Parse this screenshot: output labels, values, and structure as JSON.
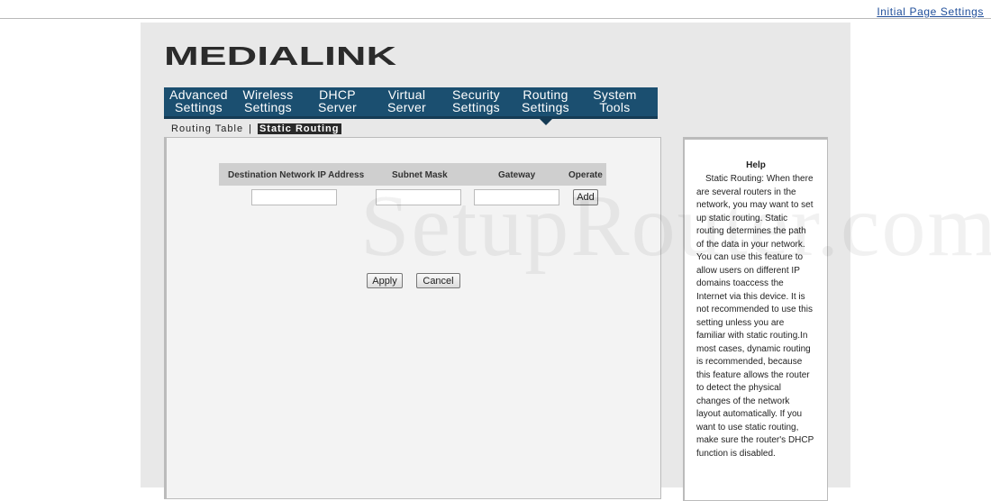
{
  "header": {
    "initial_page_settings": "Initial Page Settings"
  },
  "logo": {
    "text": "MEDIALINK",
    "color": "#2b2b2b"
  },
  "nav": {
    "items": [
      {
        "label": "Advanced\nSettings"
      },
      {
        "label": "Wireless\nSettings"
      },
      {
        "label": "DHCP\nServer"
      },
      {
        "label": "Virtual\nServer"
      },
      {
        "label": "Security\nSettings"
      },
      {
        "label": "Routing\nSettings"
      },
      {
        "label": "System\nTools"
      }
    ],
    "active_index": 5,
    "background": "#1b4f70"
  },
  "subnav": {
    "routing_table": "Routing Table",
    "separator": "|",
    "static_routing": "Static Routing"
  },
  "table": {
    "headers": {
      "destination": "Destination Network IP Address",
      "subnet": "Subnet Mask",
      "gateway": "Gateway",
      "operate": "Operate"
    },
    "inputs": {
      "destination": "",
      "subnet": "",
      "gateway": ""
    },
    "add_label": "Add"
  },
  "actions": {
    "apply": "Apply",
    "cancel": "Cancel"
  },
  "help": {
    "title": "Help",
    "text": "Static Routing: When there are several routers in the network, you may want to set up static routing. Static routing determines the path of the data in your network. You can use this feature to allow users on different IP domains toaccess the Internet via this device. It is not recommended to use this setting unless you are familiar with static routing.In most cases, dynamic routing is recommended, because this feature allows the router to detect the physical changes of the network layout automatically. If you want to use static routing, make sure the router's DHCP function is disabled."
  },
  "watermark": {
    "text": "SetupRouter.com"
  }
}
